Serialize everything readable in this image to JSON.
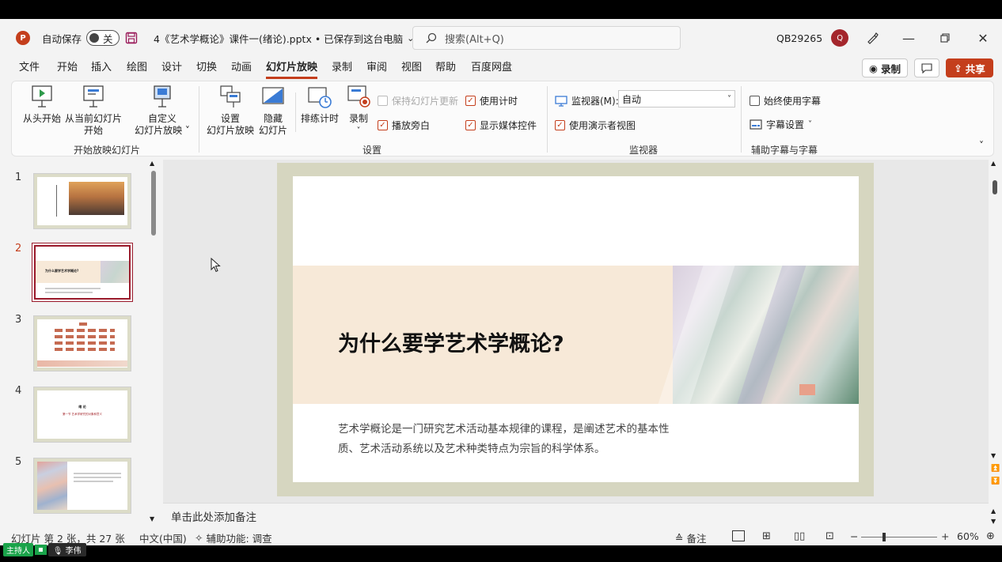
{
  "titlebar": {
    "app_icon": "P",
    "autosave_label": "自动保存",
    "autosave_state": "关",
    "document_title": "4《艺术学概论》课件一(绪论).pptx • 已保存到这台电脑",
    "search_placeholder": "搜索(Alt+Q)",
    "user_id": "QB29265",
    "avatar_initial": "Q"
  },
  "tabs": [
    "文件",
    "开始",
    "插入",
    "绘图",
    "设计",
    "切换",
    "动画",
    "幻灯片放映",
    "录制",
    "审阅",
    "视图",
    "帮助",
    "百度网盘"
  ],
  "active_tab": "幻灯片放映",
  "header_buttons": {
    "record": "录制",
    "share": "共享"
  },
  "ribbon": {
    "start_group": {
      "label": "开始放映幻灯片",
      "from_beginning": "从头开始",
      "from_current_1": "从当前幻灯片",
      "from_current_2": "开始",
      "custom_1": "自定义",
      "custom_2": "幻灯片放映"
    },
    "setup_group": {
      "label": "设置",
      "setup_1": "设置",
      "setup_2": "幻灯片放映",
      "hide_1": "隐藏",
      "hide_2": "幻灯片",
      "rehearse": "排练计时",
      "record": "录制",
      "keep_updated": "保持幻灯片更新",
      "play_narration": "播放旁白",
      "use_timings": "使用计时",
      "show_media_controls": "显示媒体控件"
    },
    "monitor_group": {
      "label": "监视器",
      "monitor_label": "监视器(M):",
      "monitor_value": "自动",
      "presenter_view": "使用演示者视图"
    },
    "captions_group": {
      "label": "辅助字幕与字幕",
      "always_captions": "始终使用字幕",
      "caption_settings": "字幕设置"
    }
  },
  "thumbnails": {
    "numbers": [
      "1",
      "2",
      "3",
      "4",
      "5"
    ],
    "selected": "2",
    "t2_title": "为什么要学艺术学概论?",
    "t4_title": "绪 论",
    "t4_sub": "第一节 艺术学研究的对象和意义"
  },
  "slide": {
    "title": "为什么要学艺术学概论?",
    "body": "艺术学概论是一门研究艺术活动基本规律的课程，是阐述艺术的基本性质、艺术活动系统以及艺术种类特点为宗旨的科学体系。"
  },
  "notes_placeholder": "单击此处添加备注",
  "status": {
    "slide_count": "幻灯片 第 2 张，共 27 张",
    "language": "中文(中国)",
    "accessibility": "辅助功能: 调查",
    "notes": "备注",
    "zoom": "60%",
    "zoom_fraction": 0.6
  },
  "overlay": {
    "host": "主持人",
    "speaker": "李伟"
  },
  "colors": {
    "accent": "#c43e1c",
    "selected_thumb": "#9a1b2c",
    "band": "#f7e9d8",
    "frame": "#d6d6c0"
  }
}
